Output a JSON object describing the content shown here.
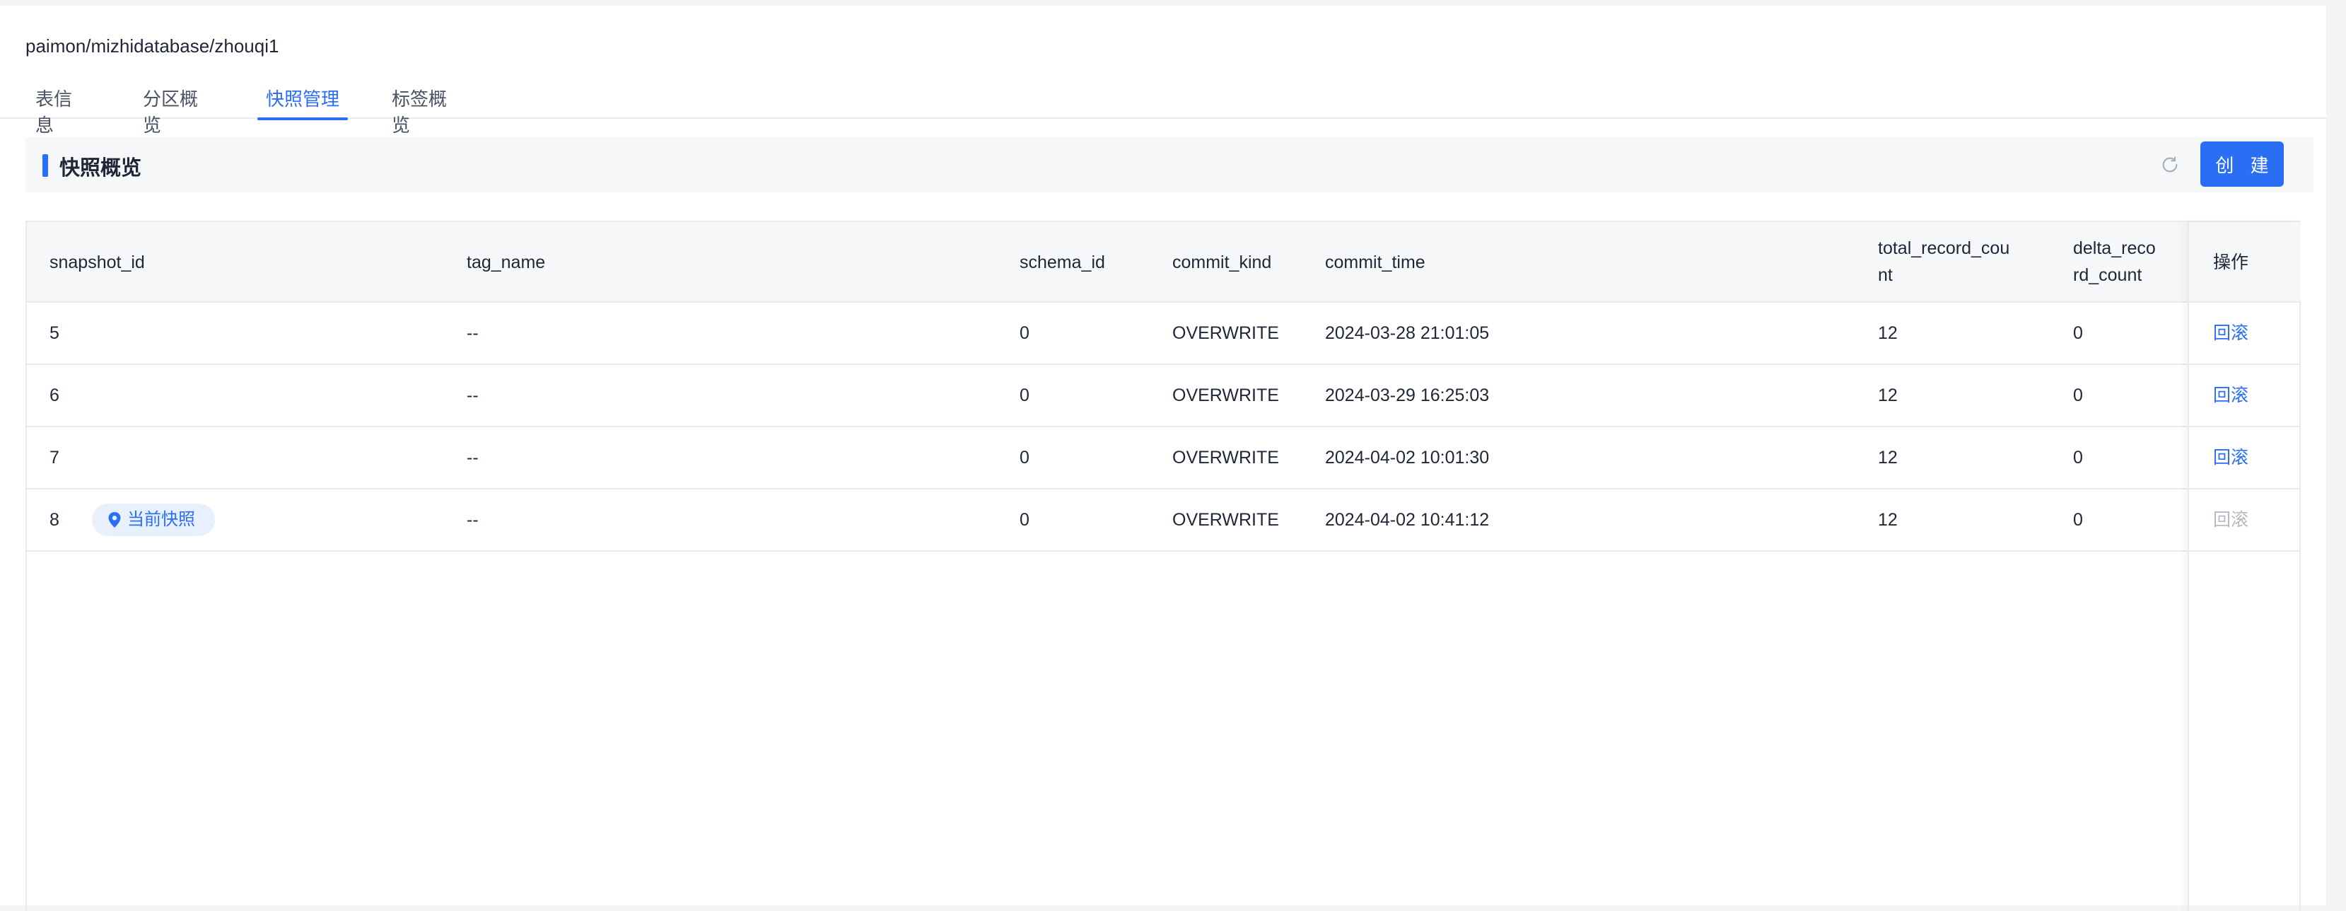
{
  "breadcrumb": "paimon/mizhidatabase/zhouqi1",
  "tabs": [
    {
      "label": "表信息",
      "active": false
    },
    {
      "label": "分区概览",
      "active": false
    },
    {
      "label": "快照管理",
      "active": true
    },
    {
      "label": "标签概览",
      "active": false
    }
  ],
  "section": {
    "title": "快照概览",
    "refresh_icon": "refresh-icon",
    "create_label": "创 建"
  },
  "table": {
    "columns": [
      "snapshot_id",
      "tag_name",
      "schema_id",
      "commit_kind",
      "commit_time",
      "total_record_count",
      "delta_record_count",
      "操作"
    ],
    "header_lines": {
      "total_record_count": [
        "total_record_cou",
        "nt"
      ],
      "delta_record_count": [
        "delta_reco",
        "rd_count"
      ]
    },
    "rows": [
      {
        "snapshot_id": "5",
        "badge": "",
        "tag_name": "--",
        "schema_id": "0",
        "commit_kind": "OVERWRITE",
        "commit_time": "2024-03-28 21:01:05",
        "total_record_count": "12",
        "delta_record_count": "0",
        "action": "回滚",
        "action_disabled": false
      },
      {
        "snapshot_id": "6",
        "badge": "",
        "tag_name": "--",
        "schema_id": "0",
        "commit_kind": "OVERWRITE",
        "commit_time": "2024-03-29 16:25:03",
        "total_record_count": "12",
        "delta_record_count": "0",
        "action": "回滚",
        "action_disabled": false
      },
      {
        "snapshot_id": "7",
        "badge": "",
        "tag_name": "--",
        "schema_id": "0",
        "commit_kind": "OVERWRITE",
        "commit_time": "2024-04-02 10:01:30",
        "total_record_count": "12",
        "delta_record_count": "0",
        "action": "回滚",
        "action_disabled": false
      },
      {
        "snapshot_id": "8",
        "badge": "当前快照",
        "tag_name": "--",
        "schema_id": "0",
        "commit_kind": "OVERWRITE",
        "commit_time": "2024-04-02 10:41:12",
        "total_record_count": "12",
        "delta_record_count": "0",
        "action": "回滚",
        "action_disabled": true
      }
    ]
  },
  "colors": {
    "accent": "#2b6ef6",
    "disabled": "#b4b9c4",
    "badge_bg": "#e8f0fe"
  }
}
